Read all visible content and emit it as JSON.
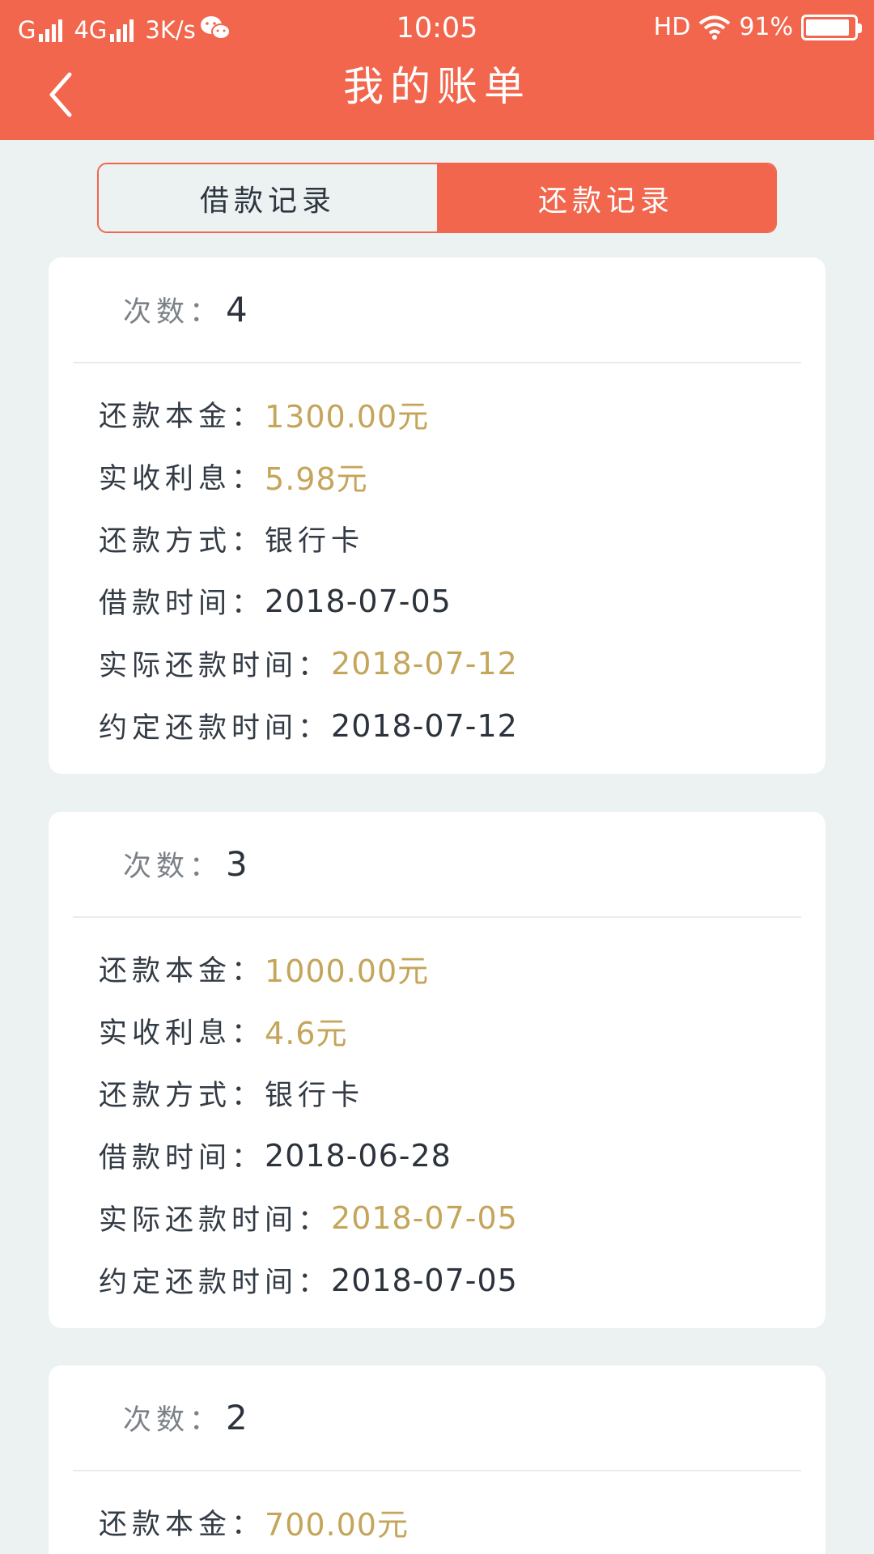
{
  "status_bar": {
    "carrier1": "G",
    "carrier2": "4G",
    "speed": "3K/s",
    "time": "10:05",
    "hd": "HD",
    "battery": "91%",
    "battery_level": 0.91
  },
  "header": {
    "title": "我的账单"
  },
  "tabs": [
    {
      "label": "借款记录",
      "active": false
    },
    {
      "label": "还款记录",
      "active": true
    }
  ],
  "labels": {
    "count": "次数：",
    "principal": "还款本金：",
    "interest": "实收利息：",
    "method": "还款方式：",
    "borrow_time": "借款时间：",
    "actual_time": "实际还款时间：",
    "due_time": "约定还款时间："
  },
  "records": [
    {
      "count": "4",
      "principal": "1300.00元",
      "interest": "5.98元",
      "method": "银行卡",
      "borrow_time": "2018-07-05",
      "actual_time": "2018-07-12",
      "due_time": "2018-07-12"
    },
    {
      "count": "3",
      "principal": "1000.00元",
      "interest": "4.6元",
      "method": "银行卡",
      "borrow_time": "2018-06-28",
      "actual_time": "2018-07-05",
      "due_time": "2018-07-05"
    },
    {
      "count": "2",
      "principal": "700.00元"
    }
  ],
  "colors": {
    "accent": "#f1664c",
    "gold": "#c4a55a",
    "background": "#ecf1f1"
  }
}
